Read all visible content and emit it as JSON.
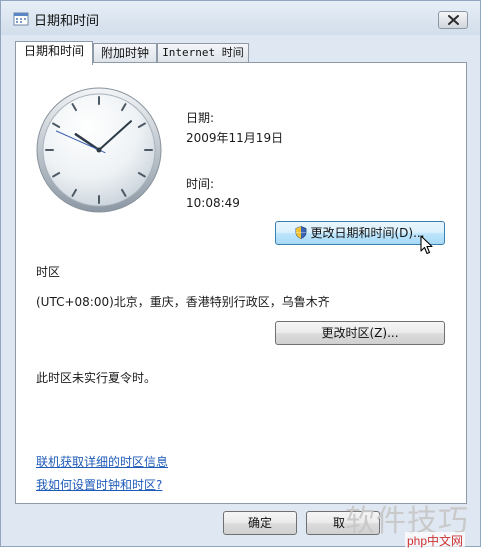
{
  "window": {
    "title": "日期和时间"
  },
  "tabs": [
    {
      "label": "日期和时间"
    },
    {
      "label": "附加时钟"
    },
    {
      "label": "Internet 时间"
    }
  ],
  "date": {
    "label": "日期:",
    "value": "2009年11月19日"
  },
  "time": {
    "label": "时间:",
    "value": "10:08:49"
  },
  "buttons": {
    "change_datetime": "更改日期和时间(D)...",
    "change_timezone": "更改时区(Z)...",
    "ok": "确定",
    "cancel": "取"
  },
  "timezone": {
    "section_label": "时区",
    "value": "(UTC+08:00)北京，重庆，香港特别行政区，乌鲁木齐",
    "dst_note": "此时区未实行夏令时。"
  },
  "links": [
    {
      "label": "联机获取详细的时区信息"
    },
    {
      "label": "我如何设置时钟和时区?"
    }
  ],
  "watermark": {
    "text": "软件技巧",
    "sub": "php中文网"
  }
}
